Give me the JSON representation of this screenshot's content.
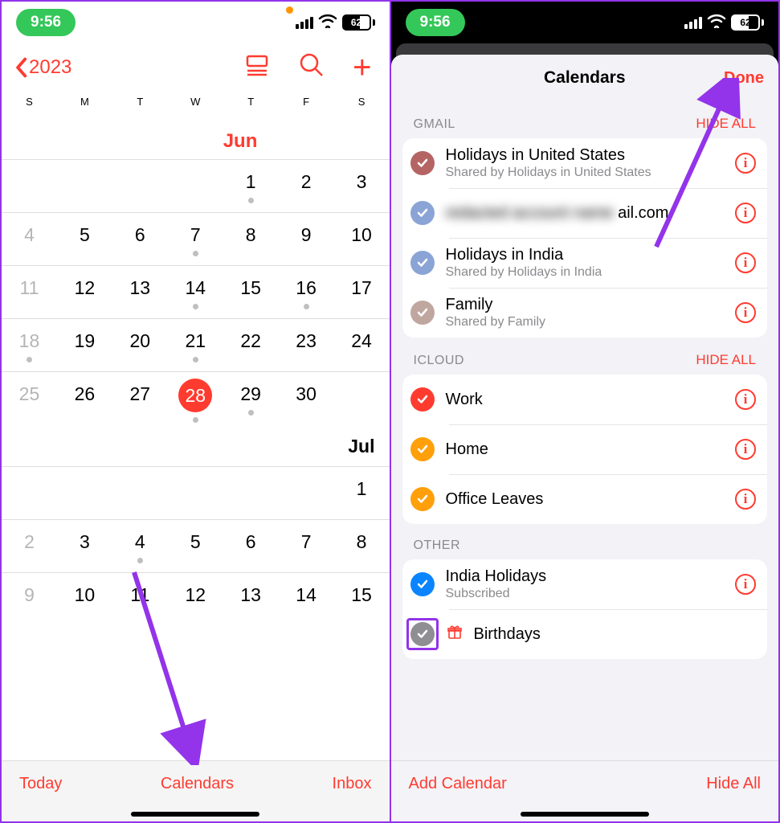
{
  "status": {
    "time": "9:56",
    "battery": "62"
  },
  "left": {
    "year": "2023",
    "weekdays": [
      "S",
      "M",
      "T",
      "W",
      "T",
      "F",
      "S"
    ],
    "month1": "Jun",
    "month2": "Jul",
    "today": 28,
    "footer": {
      "today": "Today",
      "calendars": "Calendars",
      "inbox": "Inbox"
    }
  },
  "right": {
    "title": "Calendars",
    "done": "Done",
    "sections": {
      "gmail": {
        "label": "GMAIL",
        "hide": "HIDE ALL",
        "items": [
          {
            "title": "Holidays in United States",
            "sub": "Shared by Holidays in United States",
            "color": "#b56464"
          },
          {
            "title_suffix": "ail.com",
            "sub": "",
            "color": "#8ba4d6",
            "blurred": true
          },
          {
            "title": "Holidays in India",
            "sub": "Shared by Holidays in India",
            "color": "#8ba4d6"
          },
          {
            "title": "Family",
            "sub": "Shared by Family",
            "color": "#bfa7a0"
          }
        ]
      },
      "icloud": {
        "label": "ICLOUD",
        "hide": "HIDE ALL",
        "items": [
          {
            "title": "Work",
            "color": "#ff3b30"
          },
          {
            "title": "Home",
            "color": "#ff9f0a"
          },
          {
            "title": "Office Leaves",
            "color": "#ff9f0a"
          }
        ]
      },
      "other": {
        "label": "OTHER",
        "items": [
          {
            "title": "India Holidays",
            "sub": "Subscribed",
            "color": "#0a84ff"
          },
          {
            "title": "Birthdays",
            "color": "#8e8e93",
            "gift": true
          }
        ]
      }
    },
    "footer": {
      "add": "Add Calendar",
      "hide": "Hide All"
    }
  }
}
